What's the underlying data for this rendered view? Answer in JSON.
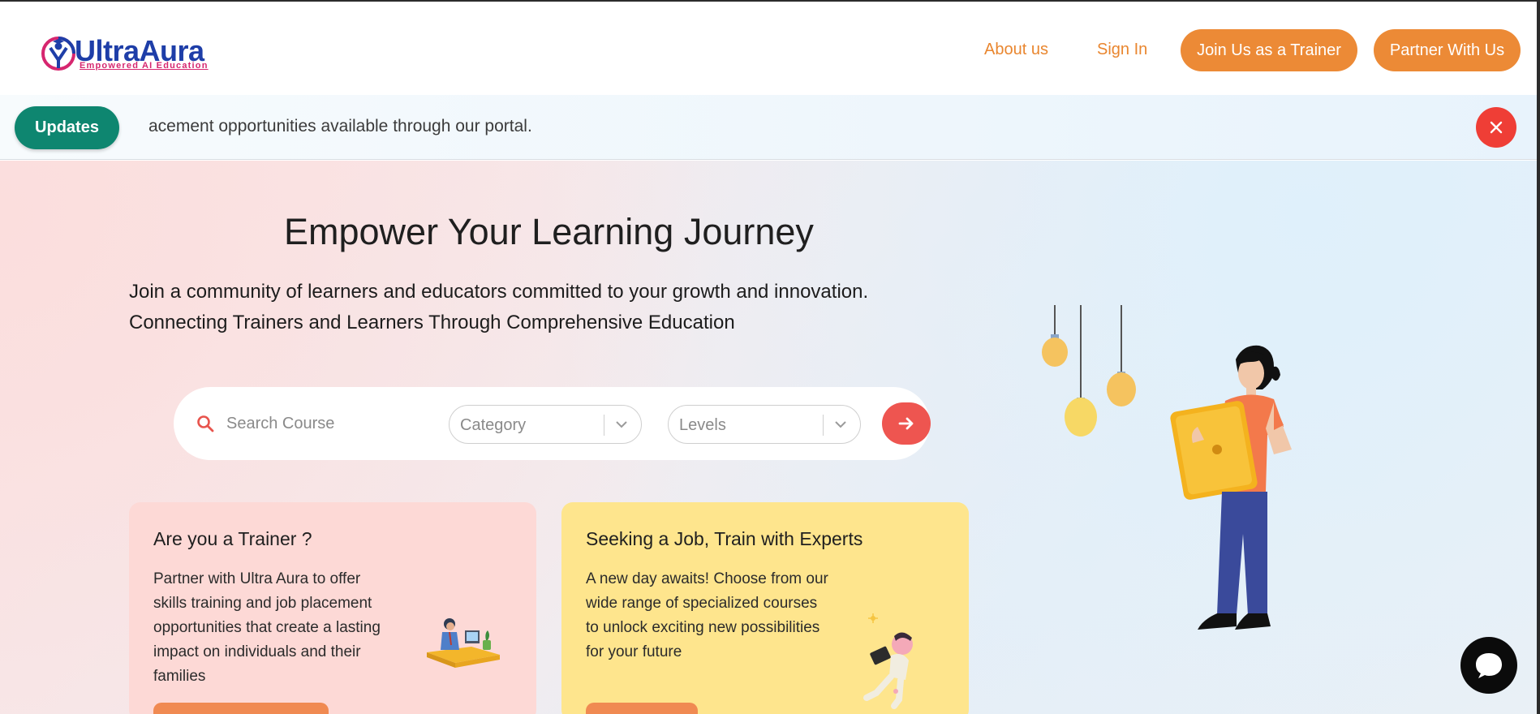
{
  "brand": {
    "name": "UltraAura",
    "tagline": "Empowered AI Education"
  },
  "nav": {
    "about": "About us",
    "signin": "Sign In",
    "join_trainer": "Join Us as a Trainer",
    "partner": "Partner With Us"
  },
  "updates": {
    "label": "Updates",
    "ticker": "acement opportunities available through our portal."
  },
  "hero": {
    "title": "Empower Your Learning Journey",
    "line1": "Join a community of learners and educators committed to your growth and innovation.",
    "line2": "Connecting Trainers and Learners Through Comprehensive Education"
  },
  "search": {
    "placeholder": "Search Course",
    "category_placeholder": "Category",
    "levels_placeholder": "Levels"
  },
  "cards": [
    {
      "title": "Are you a Trainer ?",
      "text": "Partner with Ultra Aura to offer skills training and job placement opportunities that create a lasting impact on individuals and their families"
    },
    {
      "title": "Seeking a Job, Train with Experts",
      "text": "A new day awaits! Choose from our wide range of specialized courses to unlock exciting new possibilities for your future"
    }
  ],
  "colors": {
    "accent": "#ec8a36",
    "updates": "#0e8670",
    "close": "#ef3e36",
    "go": "#ee5550",
    "card_pink": "#fdd9d6",
    "card_yellow": "#fee58d"
  },
  "icons": {
    "search": "search-icon",
    "close": "close-icon",
    "chevron": "chevron-down-icon",
    "go": "arrow-right-icon",
    "chat": "chat-bubble-icon"
  }
}
